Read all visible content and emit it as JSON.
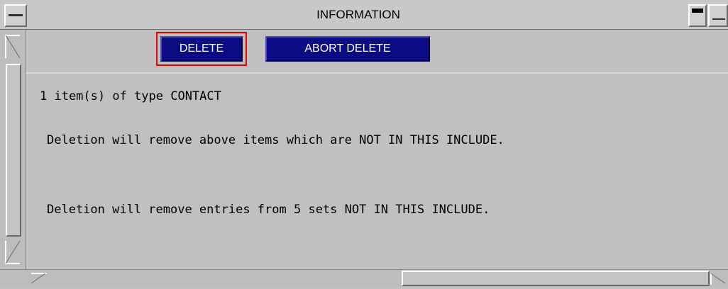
{
  "window": {
    "title": "INFORMATION"
  },
  "toolbar": {
    "delete_label": "DELETE",
    "abort_label": "ABORT DELETE"
  },
  "messages": {
    "line1": "1 item(s) of type CONTACT",
    "line2": "Deletion will remove above items which are NOT IN THIS INCLUDE.",
    "line3": "Deletion will remove entries from 5 sets NOT IN THIS INCLUDE."
  },
  "colors": {
    "button_bg": "#0b0b84",
    "focus_outline": "#e00000",
    "window_bg": "#c0c0c0"
  }
}
